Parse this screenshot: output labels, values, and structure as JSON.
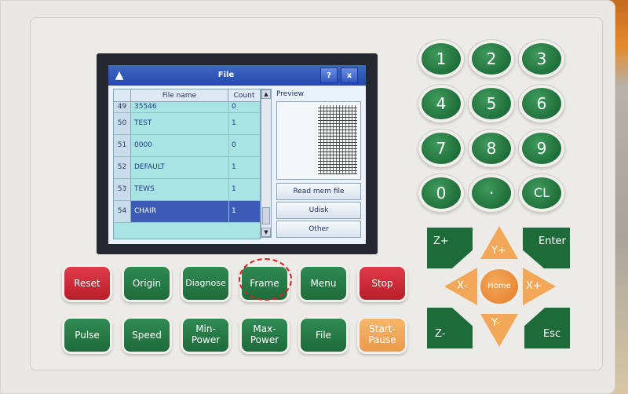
{
  "screen": {
    "title": "File",
    "help_button": "?",
    "close_button": "x",
    "logo_icon": "penguin-icon",
    "table": {
      "headers": {
        "num": "",
        "name": "File name",
        "count": "Count"
      },
      "rows": [
        {
          "num": "49",
          "name": "35546",
          "count": "0"
        },
        {
          "num": "50",
          "name": "TEST",
          "count": "1"
        },
        {
          "num": "51",
          "name": "0000",
          "count": "0"
        },
        {
          "num": "52",
          "name": "DEFAULT",
          "count": "1"
        },
        {
          "num": "53",
          "name": "TEWS",
          "count": "1"
        },
        {
          "num": "54",
          "name": "CHAIR",
          "count": "1"
        }
      ],
      "selected_row": "54"
    },
    "preview_label": "Preview",
    "buttons": {
      "read_mem_file": "Read mem file",
      "udisk": "Udisk",
      "other": "Other"
    }
  },
  "numpad": {
    "keys": [
      "1",
      "2",
      "3",
      "4",
      "5",
      "6",
      "7",
      "8",
      "9",
      "0",
      "·",
      "CL"
    ]
  },
  "function_keys": {
    "reset": "Reset",
    "origin": "Origin",
    "diagnose": "Diagnose",
    "frame": "Frame",
    "menu": "Menu",
    "stop": "Stop",
    "pulse": "Pulse",
    "speed": "Speed",
    "min_power_1": "Min-",
    "min_power_2": "Power",
    "max_power_1": "Max-",
    "max_power_2": "Power",
    "file": "File",
    "start_pause_1": "Start-",
    "start_pause_2": "Pause"
  },
  "direction_keys": {
    "z_plus": "Z+",
    "enter": "Enter",
    "y_plus": "Y+",
    "x_minus": "X-",
    "home": "Home",
    "x_plus": "X+",
    "z_minus": "Z-",
    "y_minus": "Y-",
    "esc": "Esc"
  },
  "colors": {
    "key_green": "#1e6b3a",
    "key_red": "#d02a38",
    "key_orange": "#f2a858",
    "highlight": "#e02020",
    "lcd_titlebar": "#2e53b5",
    "selected_row": "#3d5cb8"
  }
}
